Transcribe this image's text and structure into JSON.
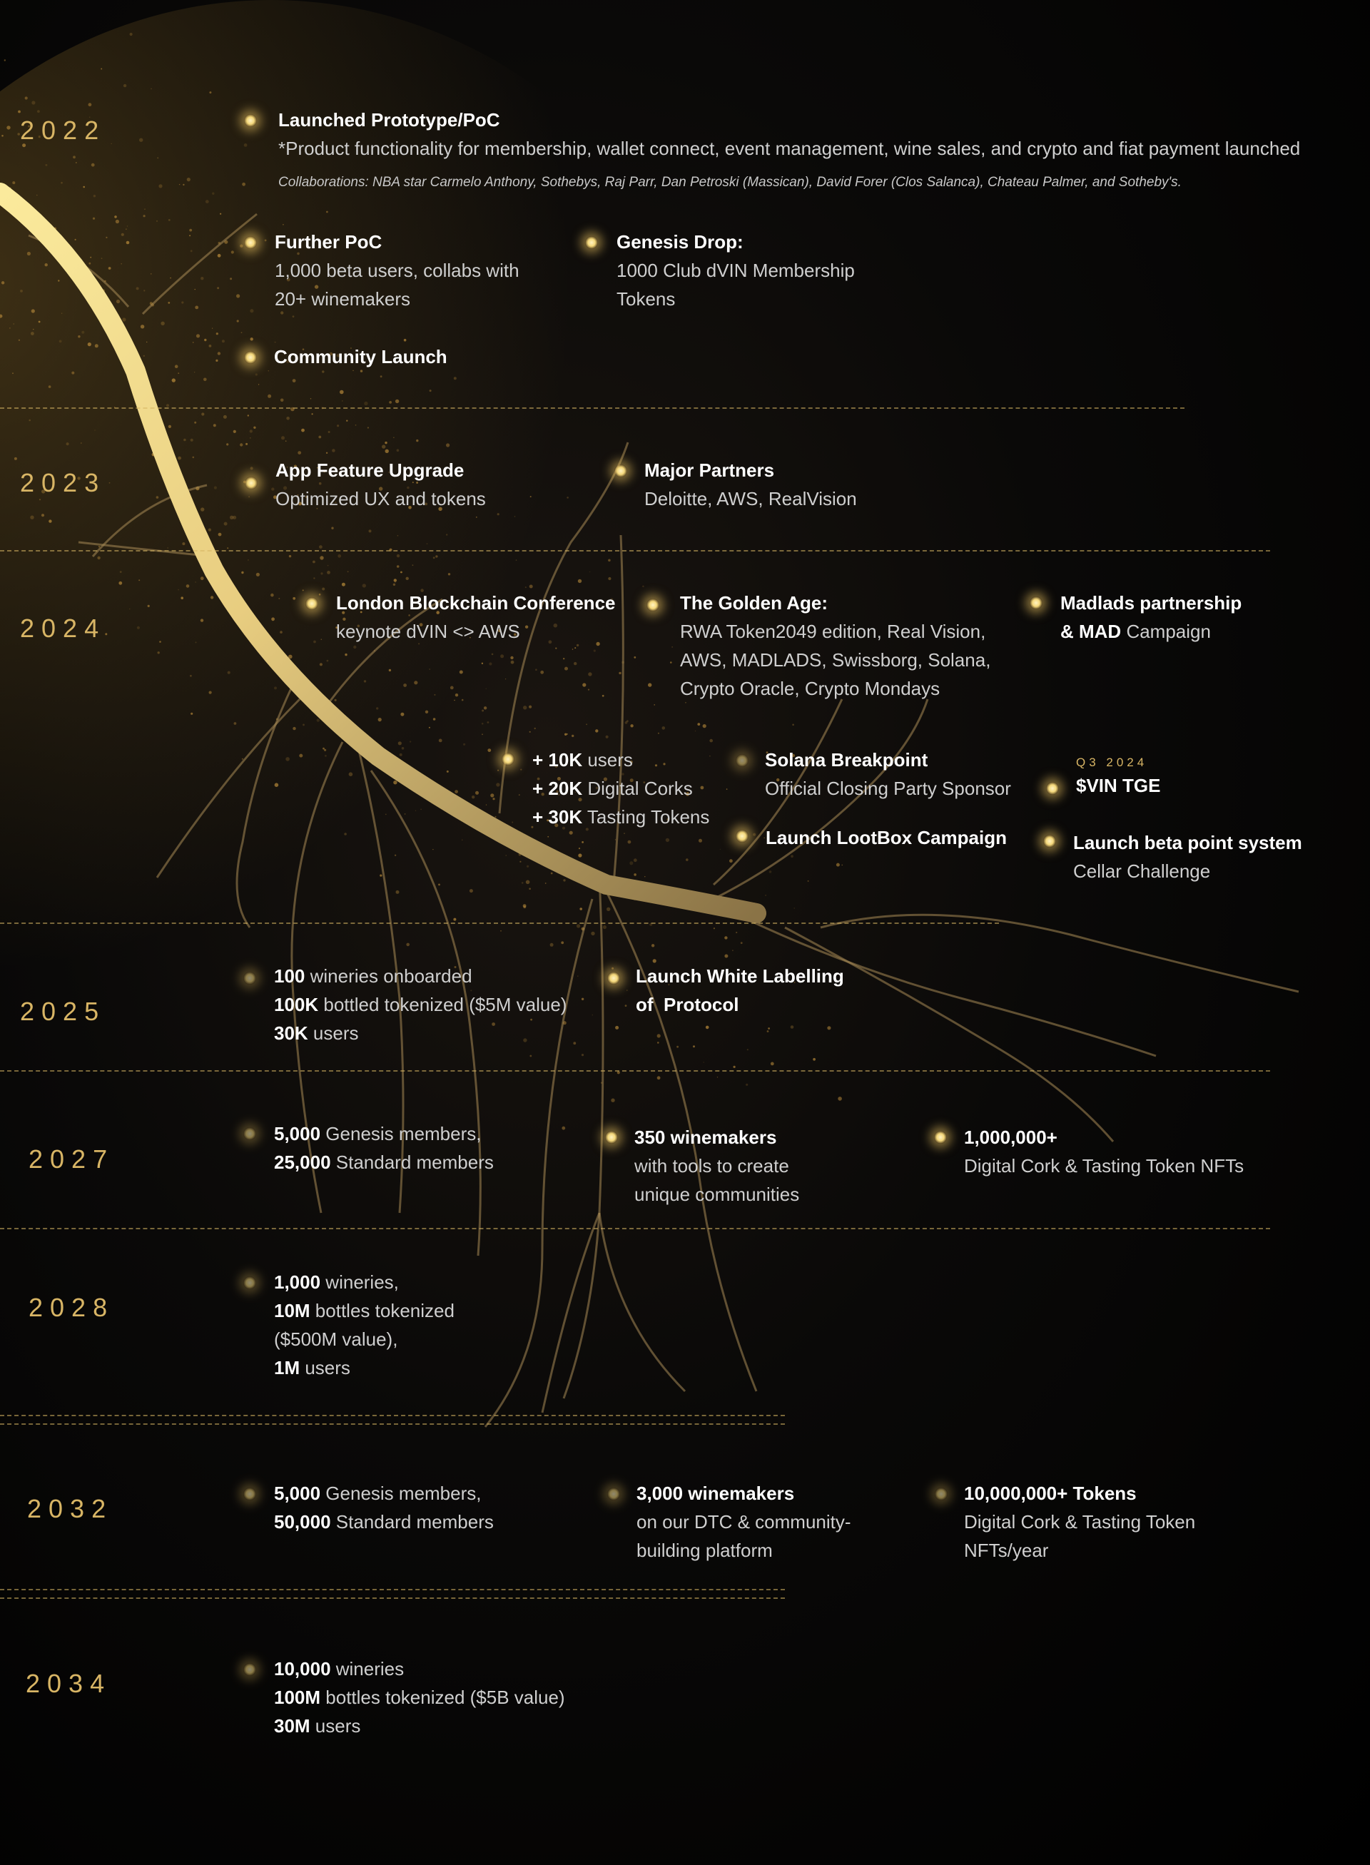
{
  "colors": {
    "accent_gold": "#d8b565",
    "trunk_gold": "#f6e08f",
    "background": "#000000"
  },
  "years": [
    "2022",
    "2023",
    "2024",
    "2025",
    "2027",
    "2028",
    "2032",
    "2034"
  ],
  "items": {
    "y2022_prototype": {
      "title": "Launched Prototype/PoC",
      "desc": "*Product functionality for membership, wallet connect, event management, wine sales, and crypto and fiat payment launched",
      "note": "Collaborations: NBA star Carmelo Anthony, Sothebys, Raj Parr, Dan Petroski (Massican), David Forer (Clos Salanca), Chateau Palmer, and Sotheby's."
    },
    "y2022_further_poc": {
      "title": "Further PoC",
      "desc": "1,000 beta users, collabs with 20+ winemakers"
    },
    "y2022_genesis": {
      "title": "Genesis Drop:",
      "desc": "1000 Club dVIN Membership Tokens"
    },
    "y2022_community": {
      "title": "Community Launch"
    },
    "y2023_app": {
      "title": "App Feature Upgrade",
      "desc": "Optimized UX and tokens"
    },
    "y2023_partners": {
      "title": "Major Partners",
      "desc": "Deloitte, AWS, RealVision"
    },
    "y2024_london": {
      "title": "London Blockchain Conference",
      "desc": "keynote dVIN <> AWS"
    },
    "y2024_golden": {
      "title": "The Golden Age:",
      "desc": "RWA Token2049 edition, Real Vision, AWS, MADLADS, Swissborg, Solana, Crypto Oracle, Crypto Mondays"
    },
    "y2024_madlads": {
      "title": "Madlads partnership",
      "b": "& MAD",
      "n": " Campaign"
    },
    "y2024_users": [
      {
        "b": "+ 10K",
        "n": " users"
      },
      {
        "b": "+ 20K",
        "n": " Digital Corks"
      },
      {
        "b": "+ 30K",
        "n": " Tasting Tokens"
      }
    ],
    "y2024_solana": {
      "title": "Solana Breakpoint",
      "desc": "Official Closing Party Sponsor"
    },
    "y2024_lootbox": {
      "title": "Launch LootBox Campaign"
    },
    "y2024_tge": {
      "quarter": "Q3 2024",
      "title": "$VIN TGE"
    },
    "y2024_beta": {
      "title": "Launch beta point system",
      "desc": "Cellar Challenge"
    },
    "y2025_wineries": [
      {
        "b": "100",
        "n": " wineries onboarded"
      },
      {
        "b": "100K",
        "n": " bottled tokenized ($5M value)"
      },
      {
        "b": "30K",
        "n": " users"
      }
    ],
    "y2025_white": {
      "title": "Launch White Labelling",
      "title2": "of  Protocol"
    },
    "y2027_members": [
      {
        "b": "5,000",
        "n": " Genesis members,"
      },
      {
        "b": "25,000",
        "n": " Standard members"
      }
    ],
    "y2027_winemakers": {
      "title": "350 winemakers",
      "desc": "with tools to create unique communities"
    },
    "y2027_nfts": {
      "title": "1,000,000+",
      "desc": "Digital Cork & Tasting Token NFTs"
    },
    "y2028_wineries": [
      {
        "b": "1,000",
        "n": " wineries,"
      },
      {
        "b": "10M",
        "n": " bottles tokenized"
      },
      {
        "b": "",
        "n": "($500M value),"
      },
      {
        "b": "1M",
        "n": " users"
      }
    ],
    "y2032_members": [
      {
        "b": "5,000",
        "n": " Genesis members,"
      },
      {
        "b": "50,000",
        "n": " Standard members"
      }
    ],
    "y2032_winemakers": {
      "title": "3,000 winemakers",
      "desc": "on our DTC & community-building platform"
    },
    "y2032_tokens": {
      "title": "10,000,000+ Tokens",
      "desc": "Digital Cork & Tasting Token NFTs/year"
    },
    "y2034_wineries": [
      {
        "b": "10,000",
        "n": " wineries"
      },
      {
        "b": "100M",
        "n": " bottles tokenized ($5B value)"
      },
      {
        "b": "30M",
        "n": " users"
      }
    ]
  }
}
